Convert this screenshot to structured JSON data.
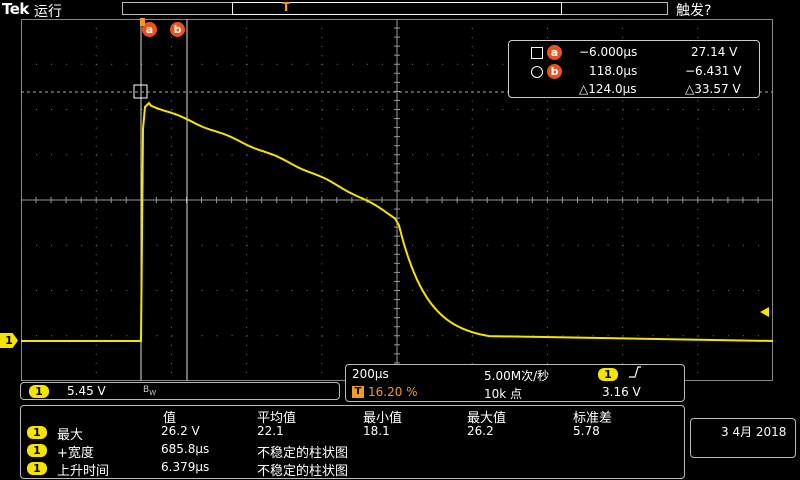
{
  "header": {
    "brand": "Tek",
    "status": "运行",
    "trigger_status": "触发?",
    "trigger_position_marker": "T"
  },
  "cursors": {
    "a_label": "a",
    "b_label": "b"
  },
  "cursor_readout": {
    "a_time": "−6.000μs",
    "a_volt": "27.14 V",
    "b_time": "118.0μs",
    "b_volt": "−6.431 V",
    "delta_time": "△124.0μs",
    "delta_volt": "△33.57 V"
  },
  "channel": {
    "number": "1",
    "scale": "5.45 V",
    "bandwidth_icon": "bw-limit-icon"
  },
  "horizontal": {
    "time_per_div": "200μs",
    "sample_rate": "5.00M次/秒",
    "trigger_marker": "T",
    "trigger_position": "16.20 %",
    "record_length": "10k 点",
    "trigger_channel": "1",
    "trigger_slope_icon": "rising-edge-icon",
    "trigger_level": "3.16 V"
  },
  "measurements": {
    "headers": [
      "值",
      "平均值",
      "最小值",
      "最大值",
      "标准差"
    ],
    "rows": [
      {
        "ch": "1",
        "name": "最大",
        "value": "26.2 V",
        "mean": "22.1",
        "min": "18.1",
        "max": "26.2",
        "std": "5.78"
      },
      {
        "ch": "1",
        "name": "+宽度",
        "value": "685.8μs",
        "stat": "不稳定的柱状图"
      },
      {
        "ch": "1",
        "name": "上升时间",
        "value": "6.379μs",
        "stat": "不稳定的柱状图"
      }
    ]
  },
  "date": {
    "text": "3 4月 2018"
  },
  "colors": {
    "trace": "#f4e400",
    "cursor": "#e8541e",
    "trigger": "#f29b22"
  }
}
